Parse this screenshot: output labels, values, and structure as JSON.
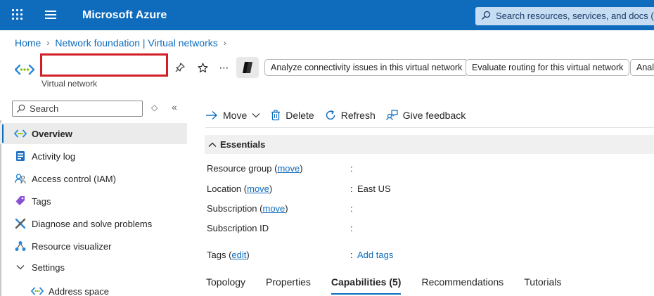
{
  "topbar": {
    "brand": "Microsoft Azure",
    "search_placeholder": "Search resources, services, and docs (G+/)",
    "accent": "#0f6cbd"
  },
  "breadcrumb": [
    "Home",
    "Network foundation | Virtual networks"
  ],
  "resource": {
    "name": "",
    "type": "Virtual network",
    "actions": [
      "Analyze connectivity issues in this virtual network",
      "Evaluate routing for this virtual network",
      "Analy"
    ]
  },
  "sidebar": {
    "search_placeholder": "Search",
    "items": [
      {
        "label": "Overview",
        "icon": "vnet-icon"
      },
      {
        "label": "Activity log",
        "icon": "activity-log-icon"
      },
      {
        "label": "Access control (IAM)",
        "icon": "iam-icon"
      },
      {
        "label": "Tags",
        "icon": "tag-icon"
      },
      {
        "label": "Diagnose and solve problems",
        "icon": "diagnose-icon"
      },
      {
        "label": "Resource visualizer",
        "icon": "visualizer-icon"
      },
      {
        "label": "Settings",
        "icon": "chevron-down-icon"
      },
      {
        "label": "Address space",
        "icon": "address-space-icon"
      }
    ]
  },
  "toolbar": {
    "move": "Move",
    "delete": "Delete",
    "refresh": "Refresh",
    "feedback": "Give feedback"
  },
  "essentials": {
    "title": "Essentials",
    "rows": [
      {
        "label": "Resource group",
        "link": "move",
        "value": ""
      },
      {
        "label": "Location",
        "link": "move",
        "value": "East US"
      },
      {
        "label": "Subscription",
        "link": "move",
        "value": ""
      },
      {
        "label": "Subscription ID",
        "link": "",
        "value": ""
      },
      {
        "label": "Tags",
        "link": "edit",
        "value": "Add tags"
      }
    ]
  },
  "tabs": [
    "Topology",
    "Properties",
    "Capabilities (5)",
    "Recommendations",
    "Tutorials"
  ]
}
